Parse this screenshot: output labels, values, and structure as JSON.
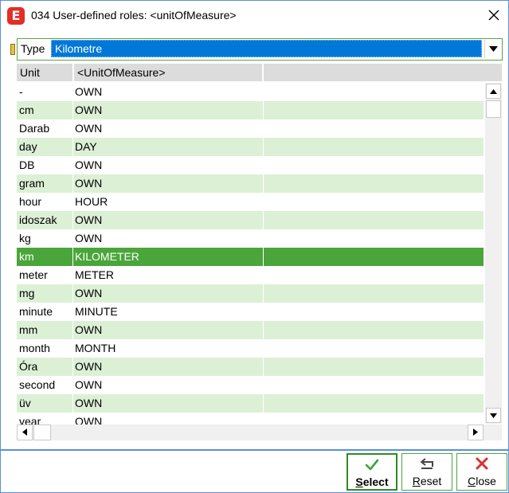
{
  "window": {
    "title": "034 User-defined roles: <unitOfMeasure>",
    "logo_letter": "E",
    "accent_color": "#e52d27"
  },
  "type_filter": {
    "label": "Type",
    "selected_value": "Kilometre"
  },
  "grid": {
    "columns": [
      "Unit",
      "<UnitOfMeasure>",
      ""
    ],
    "rows": [
      {
        "unit": "-",
        "uom": "OWN"
      },
      {
        "unit": "cm",
        "uom": "OWN"
      },
      {
        "unit": "Darab",
        "uom": "OWN"
      },
      {
        "unit": "day",
        "uom": "DAY"
      },
      {
        "unit": "DB",
        "uom": "OWN"
      },
      {
        "unit": "gram",
        "uom": "OWN"
      },
      {
        "unit": "hour",
        "uom": "HOUR"
      },
      {
        "unit": "idoszak",
        "uom": "OWN"
      },
      {
        "unit": "kg",
        "uom": "OWN"
      },
      {
        "unit": "km",
        "uom": "KILOMETER"
      },
      {
        "unit": "meter",
        "uom": "METER"
      },
      {
        "unit": "mg",
        "uom": "OWN"
      },
      {
        "unit": "minute",
        "uom": "MINUTE"
      },
      {
        "unit": "mm",
        "uom": "OWN"
      },
      {
        "unit": "month",
        "uom": "MONTH"
      },
      {
        "unit": "Óra",
        "uom": "OWN"
      },
      {
        "unit": "second",
        "uom": "OWN"
      },
      {
        "unit": "üv",
        "uom": "OWN"
      },
      {
        "unit": "year",
        "uom": "OWN"
      }
    ],
    "selected_index": 9,
    "row_colors": {
      "even": "#ffffff",
      "odd": "#dcf0d6",
      "selected": "#4aa53a"
    }
  },
  "footer": {
    "select": {
      "label_mnemonic": "S",
      "label_rest": "elect",
      "icon": "checkmark-icon"
    },
    "reset": {
      "label_mnemonic": "R",
      "label_rest": "eset",
      "icon": "reset-arrow-icon"
    },
    "close": {
      "label_mnemonic": "C",
      "label_rest": "lose",
      "icon": "x-icon"
    }
  }
}
